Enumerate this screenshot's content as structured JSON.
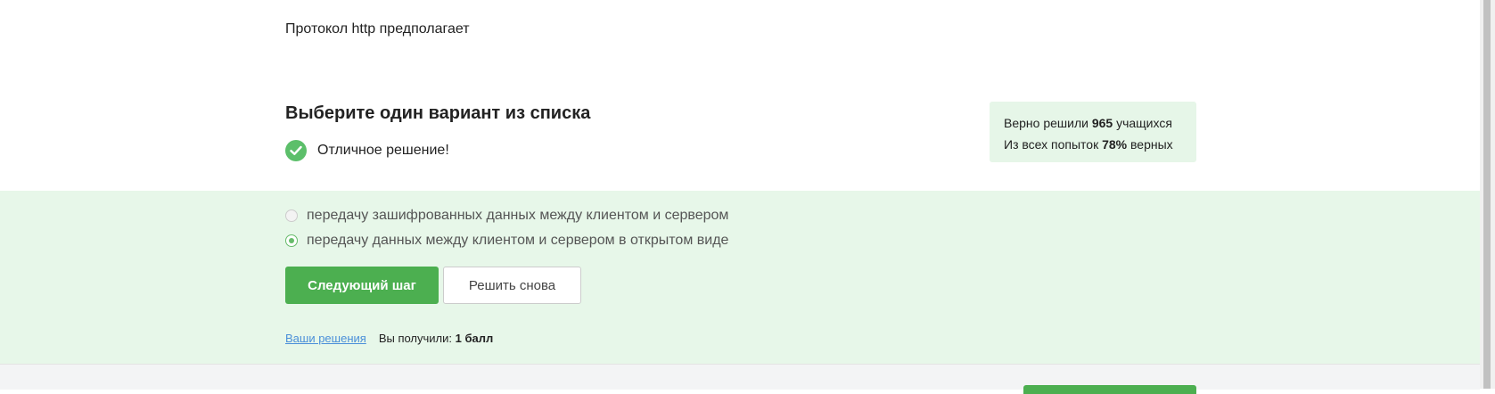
{
  "question": "Протокол http предполагает",
  "instruction": "Выберите один вариант из списка",
  "result_text": "Отличное решение!",
  "stats": {
    "line1_prefix": "Верно решили ",
    "line1_value": "965",
    "line1_suffix": " учащихся",
    "line2_prefix": "Из всех попыток ",
    "line2_value": "78%",
    "line2_suffix": " верных"
  },
  "options": [
    {
      "label": "передачу зашифрованных данных между клиентом и сервером",
      "selected": false
    },
    {
      "label": "передачу данных между клиентом и сервером в открытом виде",
      "selected": true
    }
  ],
  "buttons": {
    "next": "Следующий шаг",
    "retry": "Решить снова"
  },
  "footer": {
    "solutions_link": "Ваши решения",
    "score_prefix": "Вы получили: ",
    "score_value": "1 балл"
  },
  "colors": {
    "accent": "#4caf50",
    "success_bg": "#e7f7e9",
    "link": "#4a8fd9"
  }
}
